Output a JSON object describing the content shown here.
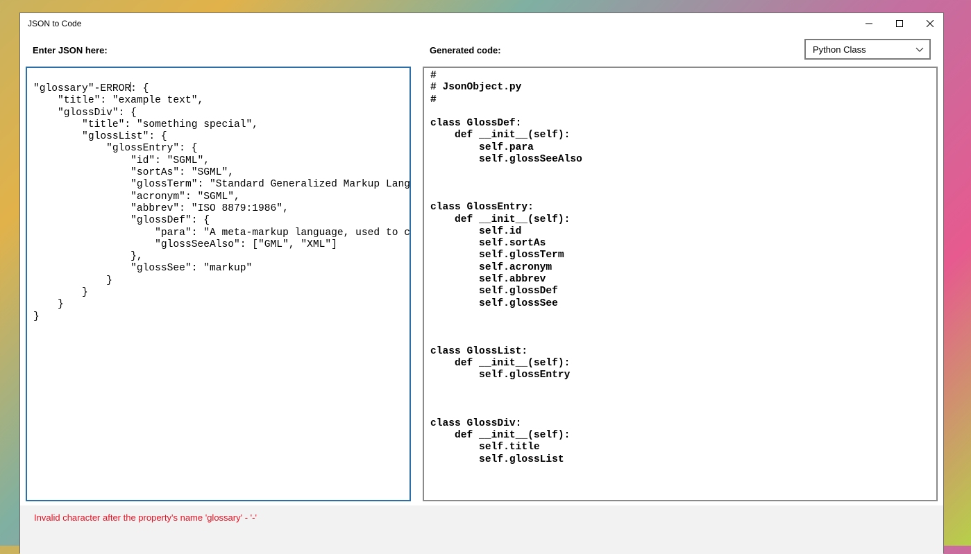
{
  "window": {
    "title": "JSON to Code",
    "controls": [
      "minimize-icon",
      "maximize-icon",
      "close-icon"
    ]
  },
  "input": {
    "label": "Enter JSON here:",
    "text_before_caret": "\"glossary\"-ERROR",
    "text_after_caret": ": {\n    \"title\": \"example text\",\n    \"glossDiv\": {\n        \"title\": \"something special\",\n        \"glossList\": {\n            \"glossEntry\": {\n                \"id\": \"SGML\",\n                \"sortAs\": \"SGML\",\n                \"glossTerm\": \"Standard Generalized Markup Language\n                \"acronym\": \"SGML\",\n                \"abbrev\": \"ISO 8879:1986\",\n                \"glossDef\": {\n                    \"para\": \"A meta-markup language, used to creat\n                    \"glossSeeAlso\": [\"GML\", \"XML\"]\n                },\n                \"glossSee\": \"markup\"\n            }\n        }\n    }\n}"
  },
  "output": {
    "label": "Generated code:",
    "language": {
      "selected": "Python Class",
      "icon": "chevron-down-icon"
    },
    "code": "#\n# JsonObject.py\n#\n\nclass GlossDef:\n    def __init__(self):\n        self.para\n        self.glossSeeAlso\n\n\n\nclass GlossEntry:\n    def __init__(self):\n        self.id\n        self.sortAs\n        self.glossTerm\n        self.acronym\n        self.abbrev\n        self.glossDef\n        self.glossSee\n\n\n\nclass GlossList:\n    def __init__(self):\n        self.glossEntry\n\n\n\nclass GlossDiv:\n    def __init__(self):\n        self.title\n        self.glossList"
  },
  "status": {
    "error": "Invalid character after the property's name 'glossary' - '-'",
    "error_color": "#e81123"
  },
  "colors": {
    "input_border_focus": "#2b6ea8",
    "output_border": "#8a8a8a"
  }
}
